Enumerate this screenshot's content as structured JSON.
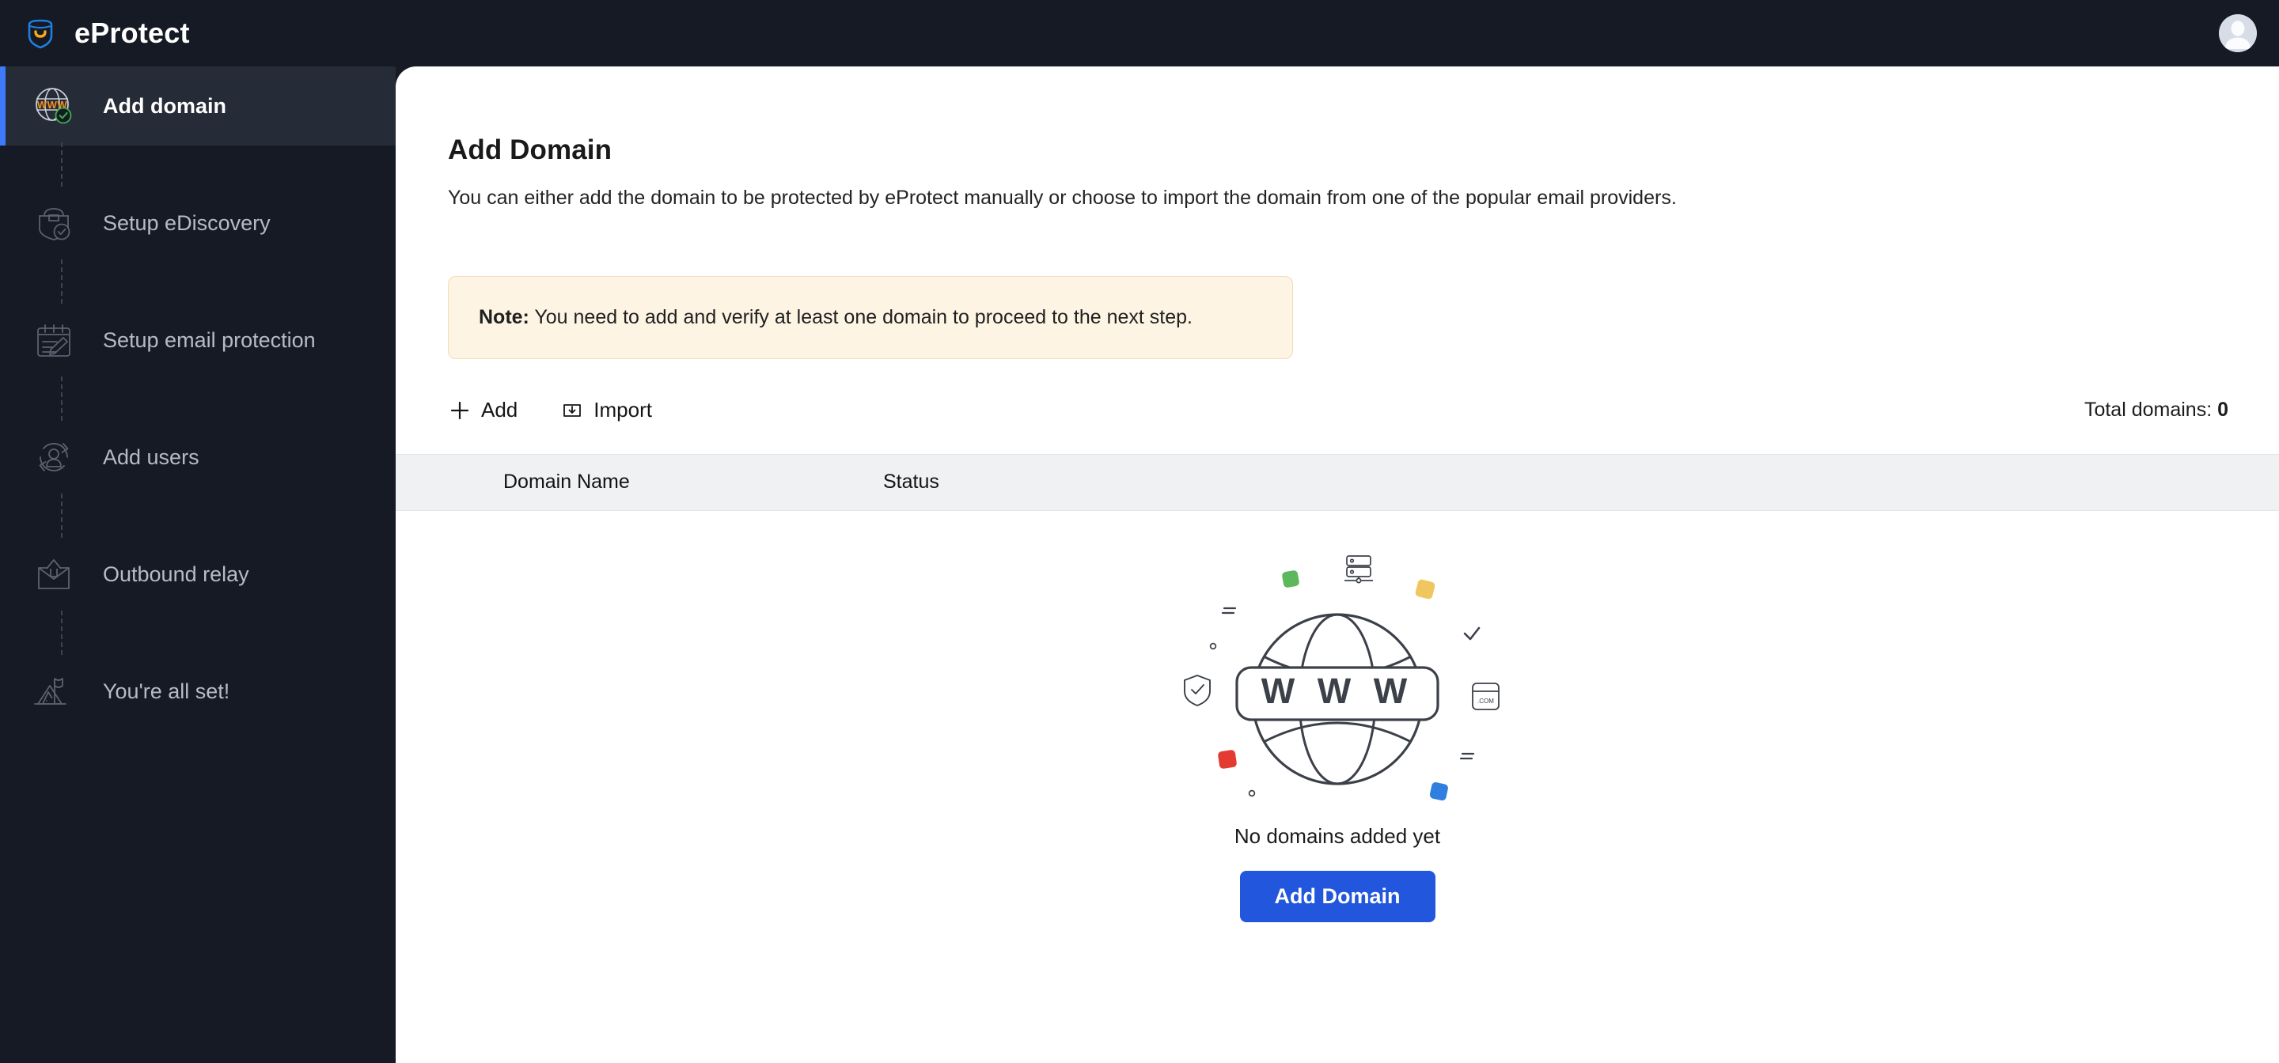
{
  "app": {
    "name": "eProtect",
    "logo_icon": "shield-badge-icon",
    "avatar_icon": "user-avatar-icon"
  },
  "sidebar": {
    "items": [
      {
        "label": "Add domain",
        "icon": "globe-www-verified-icon",
        "active": true
      },
      {
        "label": "Setup eDiscovery",
        "icon": "briefcase-check-icon",
        "active": false
      },
      {
        "label": "Setup email protection",
        "icon": "calendar-pencil-icon",
        "active": false
      },
      {
        "label": "Add users",
        "icon": "user-sync-icon",
        "active": false
      },
      {
        "label": "Outbound relay",
        "icon": "envelope-upload-icon",
        "active": false
      },
      {
        "label": "You're all set!",
        "icon": "mountain-flag-icon",
        "active": false
      }
    ]
  },
  "main": {
    "title": "Add Domain",
    "subtitle": "You can either add the domain to be protected by eProtect manually or choose to import the domain from one of the popular email providers.",
    "note": {
      "label": "Note:",
      "text": " You need to add and verify at least one domain to proceed to the next step."
    },
    "toolbar": {
      "add_label": "Add",
      "add_icon": "plus-icon",
      "import_label": "Import",
      "import_icon": "import-download-icon",
      "total_label": "Total domains: ",
      "total_value": "0"
    },
    "table": {
      "columns": [
        "Domain Name",
        "Status"
      ],
      "rows": []
    },
    "empty_state": {
      "illustration_icon": "globe-www-illustration",
      "illustration_labels": {
        "banner": "W W W",
        "browser_tag": ".COM"
      },
      "message": "No domains added yet",
      "button_label": "Add Domain"
    }
  },
  "colors": {
    "sidebar_bg": "#151a24",
    "sidebar_active_bg": "#252b37",
    "accent_blue": "#3d7bfb",
    "button_blue": "#2256dd",
    "note_bg": "#fdf4e4",
    "note_border": "#f3ddb6",
    "table_head_bg": "#f0f1f3",
    "illus_green": "#5cb85c",
    "illus_yellow": "#f0c75e",
    "illus_red": "#e33b32",
    "illus_blue": "#2f7fe0",
    "www_orange": "#f5921e",
    "check_green": "#3fae4a"
  }
}
